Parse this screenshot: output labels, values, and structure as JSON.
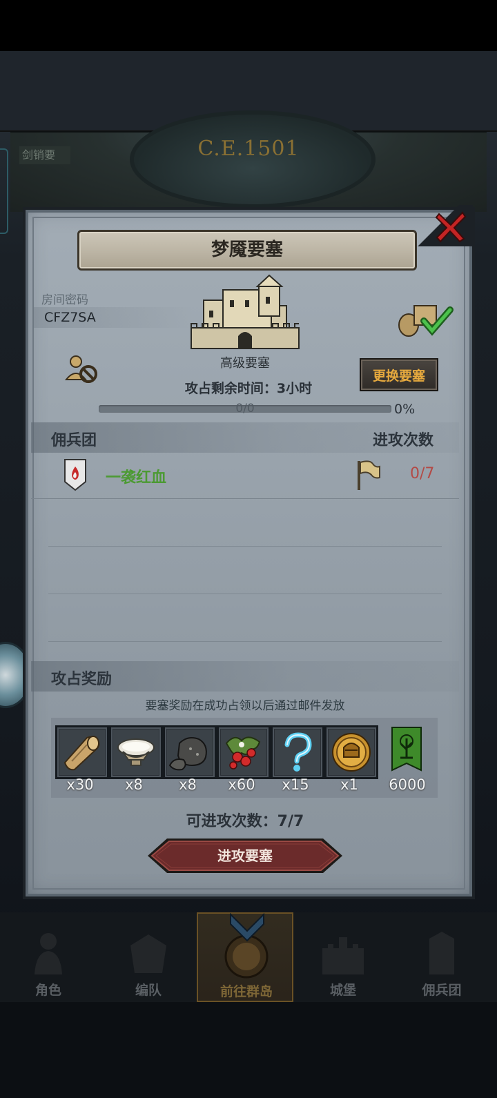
{
  "era": {
    "label": "C.E.1501",
    "tag": "剑销要"
  },
  "dialog": {
    "title": "梦魇要塞",
    "close_icon": "close-x-icon"
  },
  "room": {
    "label": "房间密码",
    "code": "CFZ7SA"
  },
  "fortress": {
    "level_label": "高级要塞",
    "change_button": "更换要塞",
    "time_remaining": "攻占剩余时间：3小时",
    "progress_count": "0/0",
    "progress_percent": "0%",
    "progress_value": 0
  },
  "mercenary_section": {
    "header_left": "佣兵团",
    "header_right": "进攻次数",
    "rows": [
      {
        "name": "一袭红血",
        "attacks": "0/7"
      }
    ]
  },
  "reward_section": {
    "header": "攻占奖励",
    "note": "要塞奖励在成功占领以后通过邮件发放",
    "items": [
      {
        "icon": "wood-log-icon",
        "count": "x30"
      },
      {
        "icon": "stone-bowl-icon",
        "count": "x8"
      },
      {
        "icon": "ore-rock-icon",
        "count": "x8"
      },
      {
        "icon": "red-berries-icon",
        "count": "x60"
      },
      {
        "icon": "blue-mystery-icon",
        "count": "x15"
      },
      {
        "icon": "knight-helmet-coin-icon",
        "count": "x1"
      },
      {
        "icon": "tree-banner-icon",
        "count": "6000"
      }
    ]
  },
  "attack": {
    "available_attempts": "可进攻次数：7/7",
    "button_label": "进攻要塞"
  },
  "bottom_nav": [
    {
      "label": "角色",
      "icon": "knight-icon"
    },
    {
      "label": "编队",
      "icon": "armor-icon"
    },
    {
      "label": "前往群岛",
      "icon": "compass-icon",
      "active": true
    },
    {
      "label": "城堡",
      "icon": "castle-icon"
    },
    {
      "label": "佣兵团",
      "icon": "mercenary-icon"
    }
  ],
  "colors": {
    "title_text": "#2a2620",
    "button_gold": "#e6a93e",
    "merc_name_green": "#4c9a33",
    "attack_count_red": "#b34a46",
    "attack_button": "#6b2b2b"
  }
}
